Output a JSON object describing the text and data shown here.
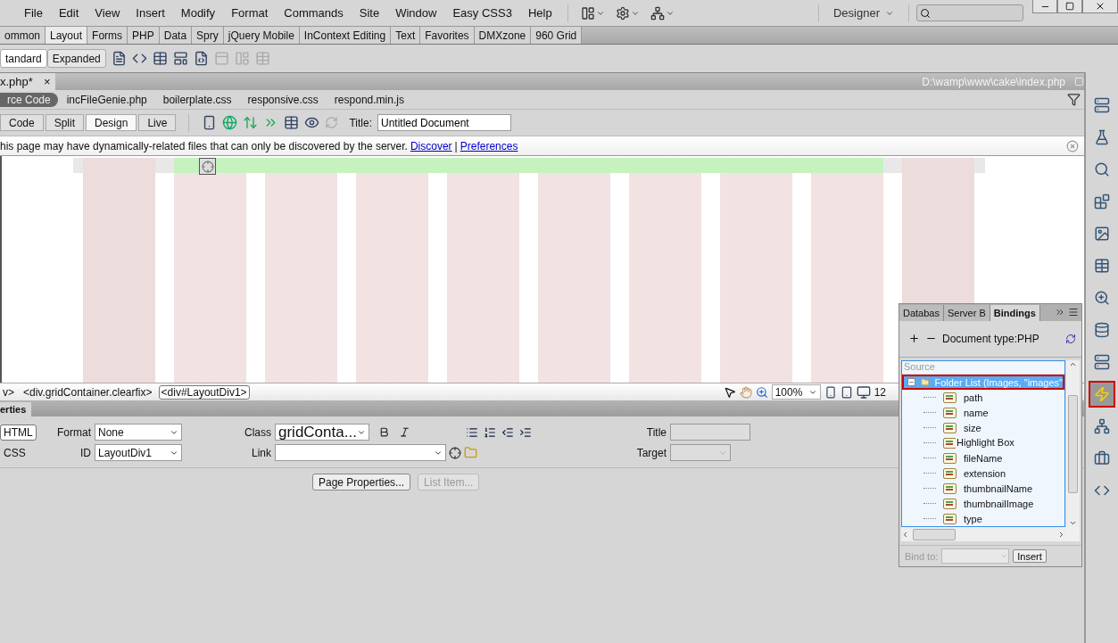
{
  "menu_bar": {
    "items": [
      "File",
      "Edit",
      "View",
      "Insert",
      "Modify",
      "Format",
      "Commands",
      "Site",
      "Window",
      "Easy CSS3",
      "Help"
    ],
    "workspace": "Designer"
  },
  "insert_tabs": [
    {
      "label": "ommon",
      "selected": false
    },
    {
      "label": "Layout",
      "selected": true
    },
    {
      "label": "Forms",
      "selected": false
    },
    {
      "label": "PHP",
      "selected": false
    },
    {
      "label": "Data",
      "selected": false
    },
    {
      "label": "Spry",
      "selected": false
    },
    {
      "label": "jQuery Mobile",
      "selected": false
    },
    {
      "label": "InContext Editing",
      "selected": false
    },
    {
      "label": "Text",
      "selected": false
    },
    {
      "label": "Favorites",
      "selected": false
    },
    {
      "label": "DMXzone",
      "selected": false
    },
    {
      "label": "960 Grid",
      "selected": false
    }
  ],
  "insert_modes": [
    {
      "label": "tandard",
      "selected": true
    },
    {
      "label": "Expanded",
      "selected": false
    }
  ],
  "document": {
    "tab": "x.php*",
    "close": "×",
    "path": "D:\\wamp\\www\\cake\\index.php"
  },
  "related_files": [
    {
      "label": "rce Code",
      "selected": true
    },
    {
      "label": "incFileGenie.php",
      "selected": false
    },
    {
      "label": "boilerplate.css",
      "selected": false
    },
    {
      "label": "responsive.css",
      "selected": false
    },
    {
      "label": "respond.min.js",
      "selected": false
    }
  ],
  "view_buttons": [
    {
      "label": "Code",
      "selected": false
    },
    {
      "label": "Split",
      "selected": false
    },
    {
      "label": "Design",
      "selected": true
    },
    {
      "label": "Live",
      "selected": false
    }
  ],
  "title_field": {
    "label": "Title:",
    "value": "Untitled Document"
  },
  "info_bar": {
    "message": "his page may have dynamically-related files that can only be discovered by the server.",
    "links": [
      "Discover",
      "Preferences"
    ],
    "separator": "|"
  },
  "tag_selector": [
    {
      "label": "v>",
      "selected": false
    },
    {
      "label": "<div.gridContainer.clearfix>",
      "selected": false
    },
    {
      "label": "<div#LayoutDiv1>",
      "selected": true
    }
  ],
  "status": {
    "zoom": "100%",
    "window_size": "12"
  },
  "properties": {
    "title": "erties",
    "modes": [
      {
        "label": "HTML",
        "selected": true
      },
      {
        "label": "CSS",
        "selected": false
      }
    ],
    "format": {
      "label": "Format",
      "value": "None"
    },
    "id": {
      "label": "ID",
      "value": "LayoutDiv1"
    },
    "class": {
      "label": "Class",
      "value": "gridConta..."
    },
    "link": {
      "label": "Link"
    },
    "title_field": {
      "label": "Title",
      "disabled": true
    },
    "target": {
      "label": "Target",
      "disabled": true
    },
    "buttons": [
      {
        "label": "Page Properties...",
        "disabled": false
      },
      {
        "label": "List Item...",
        "disabled": true
      }
    ]
  },
  "bindings_panel": {
    "tabs": [
      {
        "label": "Databas",
        "selected": false
      },
      {
        "label": "Server B",
        "selected": false
      },
      {
        "label": "Bindings",
        "selected": true
      }
    ],
    "document_type": "Document type:PHP",
    "column": "Source",
    "tree": {
      "label": "Folder List (Images, \"images\"",
      "expanded": true,
      "selected": true,
      "children": [
        {
          "kind": "field",
          "label": "path"
        },
        {
          "kind": "field",
          "label": "name"
        },
        {
          "kind": "field",
          "label": "size"
        },
        {
          "kind": "covered"
        },
        {
          "kind": "field",
          "label": "fileName"
        },
        {
          "kind": "field",
          "label": "extension"
        },
        {
          "kind": "field",
          "label": "thumbnailName"
        },
        {
          "kind": "field",
          "label": "thumbnailImage"
        },
        {
          "kind": "field",
          "label": "type"
        }
      ]
    },
    "tooltip": "Highlight Box",
    "bind_to": {
      "label": "Bind to:",
      "disabled": true
    },
    "insert": "Insert"
  },
  "dock": [
    {
      "selected": false
    },
    {
      "selected": false
    },
    {
      "selected": false
    },
    {
      "selected": false
    },
    {
      "selected": false
    },
    {
      "selected": false
    },
    {
      "selected": false
    },
    {
      "selected": false
    },
    {
      "selected": false
    },
    {
      "selected": true
    },
    {
      "selected": false
    },
    {
      "selected": false
    },
    {
      "selected": false
    }
  ]
}
